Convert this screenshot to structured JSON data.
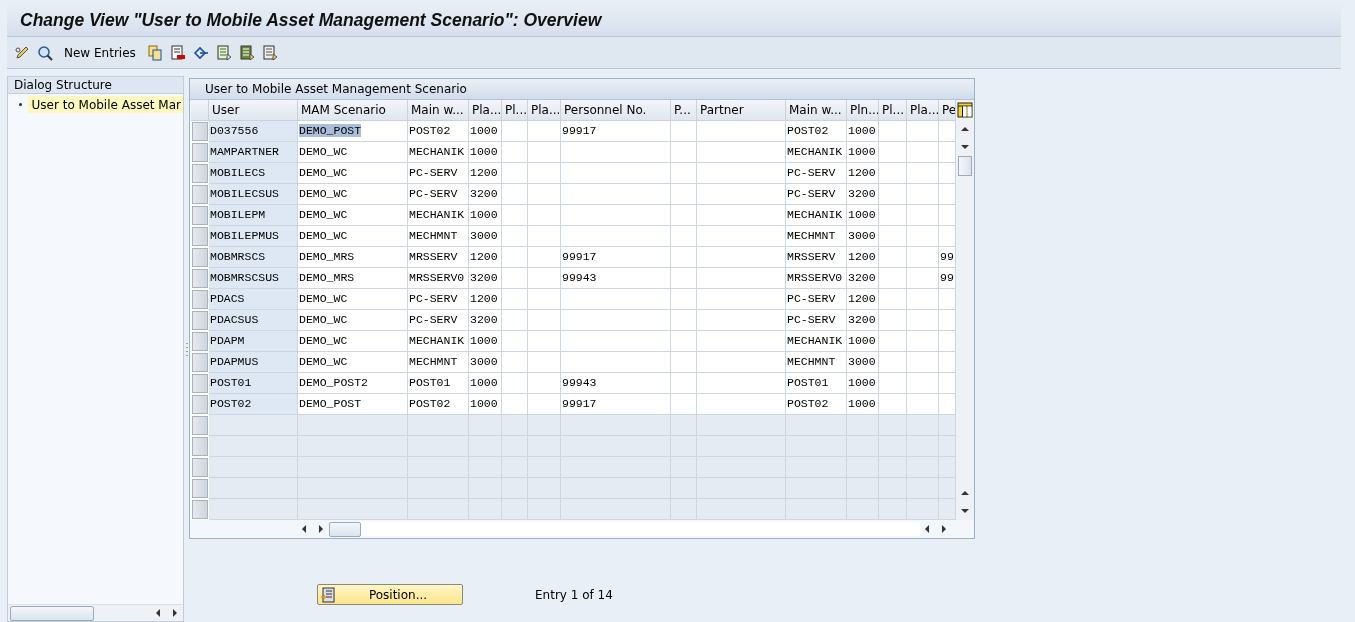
{
  "window": {
    "title": "Change View \"User to Mobile Asset Management Scenario\": Overview"
  },
  "toolbar": {
    "new_entries": "New Entries"
  },
  "dialog_structure": {
    "title": "Dialog Structure",
    "items": [
      {
        "label": "User to Mobile Asset Mar",
        "selected": true
      }
    ]
  },
  "table": {
    "title": "User to Mobile Asset Management Scenario",
    "columns": [
      "User",
      "MAM Scenario",
      "Main w...",
      "Pla...",
      "Pl...",
      "Pla...",
      "Personnel No.",
      "P...",
      "Partner",
      "Main w...",
      "Pln...",
      "Pl...",
      "Pla...",
      "Pe"
    ],
    "rows": [
      {
        "cells": [
          "D037556",
          "DEMO_POST",
          "POST02",
          "1000",
          "",
          "",
          "99917",
          "",
          "",
          "POST02",
          "1000",
          "",
          "",
          ""
        ],
        "scenario_selected": true
      },
      {
        "cells": [
          "MAMPARTNER",
          "DEMO_WC",
          "MECHANIK",
          "1000",
          "",
          "",
          "",
          "",
          "",
          "MECHANIK",
          "1000",
          "",
          "",
          ""
        ],
        "scenario_selected": false
      },
      {
        "cells": [
          "MOBILECS",
          "DEMO_WC",
          "PC-SERV",
          "1200",
          "",
          "",
          "",
          "",
          "",
          "PC-SERV",
          "1200",
          "",
          "",
          ""
        ],
        "scenario_selected": false
      },
      {
        "cells": [
          "MOBILECSUS",
          "DEMO_WC",
          "PC-SERV",
          "3200",
          "",
          "",
          "",
          "",
          "",
          "PC-SERV",
          "3200",
          "",
          "",
          ""
        ],
        "scenario_selected": false
      },
      {
        "cells": [
          "MOBILEPM",
          "DEMO_WC",
          "MECHANIK",
          "1000",
          "",
          "",
          "",
          "",
          "",
          "MECHANIK",
          "1000",
          "",
          "",
          ""
        ],
        "scenario_selected": false
      },
      {
        "cells": [
          "MOBILEPMUS",
          "DEMO_WC",
          "MECHMNT",
          "3000",
          "",
          "",
          "",
          "",
          "",
          "MECHMNT",
          "3000",
          "",
          "",
          ""
        ],
        "scenario_selected": false
      },
      {
        "cells": [
          "MOBMRSCS",
          "DEMO_MRS",
          "MRSSERV",
          "1200",
          "",
          "",
          "99917",
          "",
          "",
          "MRSSERV",
          "1200",
          "",
          "",
          "99"
        ],
        "scenario_selected": false
      },
      {
        "cells": [
          "MOBMRSCSUS",
          "DEMO_MRS",
          "MRSSERV0",
          "3200",
          "",
          "",
          "99943",
          "",
          "",
          "MRSSERV0",
          "3200",
          "",
          "",
          "99"
        ],
        "scenario_selected": false
      },
      {
        "cells": [
          "PDACS",
          "DEMO_WC",
          "PC-SERV",
          "1200",
          "",
          "",
          "",
          "",
          "",
          "PC-SERV",
          "1200",
          "",
          "",
          ""
        ],
        "scenario_selected": false
      },
      {
        "cells": [
          "PDACSUS",
          "DEMO_WC",
          "PC-SERV",
          "3200",
          "",
          "",
          "",
          "",
          "",
          "PC-SERV",
          "3200",
          "",
          "",
          ""
        ],
        "scenario_selected": false
      },
      {
        "cells": [
          "PDAPM",
          "DEMO_WC",
          "MECHANIK",
          "1000",
          "",
          "",
          "",
          "",
          "",
          "MECHANIK",
          "1000",
          "",
          "",
          ""
        ],
        "scenario_selected": false
      },
      {
        "cells": [
          "PDAPMUS",
          "DEMO_WC",
          "MECHMNT",
          "3000",
          "",
          "",
          "",
          "",
          "",
          "MECHMNT",
          "3000",
          "",
          "",
          ""
        ],
        "scenario_selected": false
      },
      {
        "cells": [
          "POST01",
          "DEMO_POST2",
          "POST01",
          "1000",
          "",
          "",
          "99943",
          "",
          "",
          "POST01",
          "1000",
          "",
          "",
          ""
        ],
        "scenario_selected": false
      },
      {
        "cells": [
          "POST02",
          "DEMO_POST",
          "POST02",
          "1000",
          "",
          "",
          "99917",
          "",
          "",
          "POST02",
          "1000",
          "",
          "",
          ""
        ],
        "scenario_selected": false
      }
    ]
  },
  "footer": {
    "position_button": "Position...",
    "entry_info": "Entry 1 of 14"
  }
}
